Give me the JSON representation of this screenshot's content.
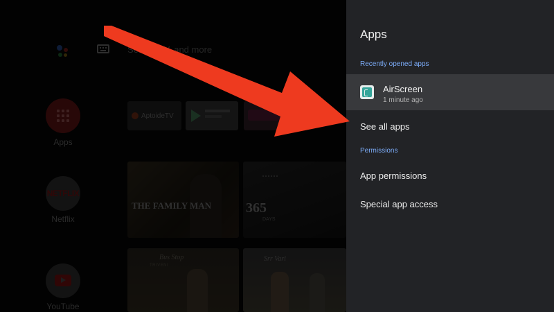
{
  "home": {
    "search_text": "Search TV, and more",
    "favorites": [
      {
        "label": "Apps"
      },
      {
        "label": "Netflix",
        "logo_text": "NETFLIX"
      },
      {
        "label": "YouTube"
      }
    ],
    "app_row": [
      {
        "label": "AptoideTV"
      }
    ],
    "shows": [
      {
        "title_text": "THE FAMILY MAN"
      },
      {
        "title_text": "365",
        "subtitle_text": "DAYS"
      },
      {
        "title_text": "Bus Stop",
        "subtitle_text": "TRIVENI"
      },
      {
        "title_text": "Srr Vari"
      }
    ]
  },
  "panel": {
    "title": "Apps",
    "recent_header": "Recently opened apps",
    "recent_apps": [
      {
        "name": "AirScreen",
        "time": "1 minute ago",
        "icon": "airscreen-icon"
      }
    ],
    "see_all": "See all apps",
    "permissions_header": "Permissions",
    "app_permissions": "App permissions",
    "special_access": "Special app access"
  },
  "colors": {
    "panel_bg": "#222326",
    "selected_bg": "#38393c",
    "section_header": "#7cacf8",
    "arrow": "#ee3a1f"
  },
  "icons": [
    "google-assistant-icon",
    "keyboard-icon",
    "apps-grid-icon",
    "netflix-logo",
    "youtube-icon",
    "play-store-icon",
    "aptoide-icon",
    "airscreen-icon"
  ]
}
